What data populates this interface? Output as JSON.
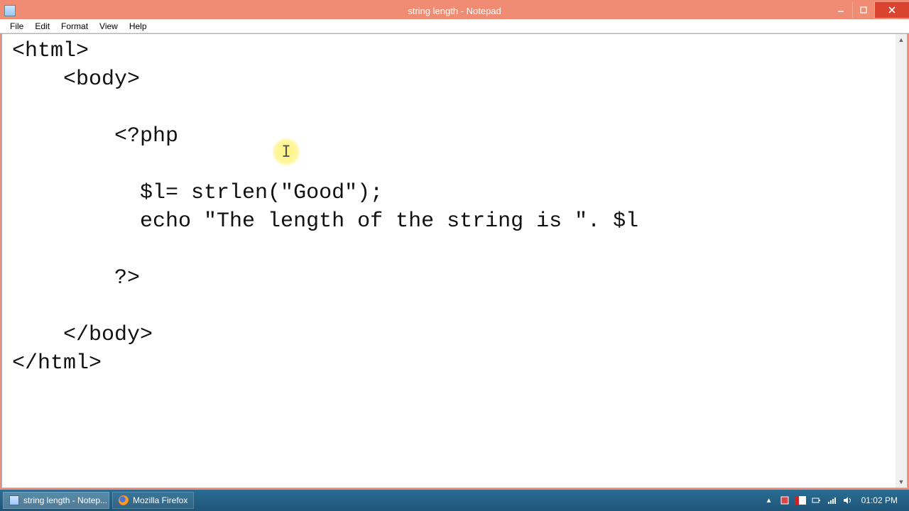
{
  "window": {
    "title": "string length - Notepad"
  },
  "menu": {
    "file": "File",
    "edit": "Edit",
    "format": "Format",
    "view": "View",
    "help": "Help"
  },
  "editor": {
    "content": "<html>\n    <body>\n\n        <?php\n\n          $l= strlen(\"Good\");\n          echo \"The length of the string is \". $l\n\n        ?>\n\n    </body>\n</html>"
  },
  "taskbar": {
    "items": [
      {
        "label": "string length - Notep..."
      },
      {
        "label": "Mozilla Firefox"
      }
    ],
    "time": "01:02 PM"
  }
}
